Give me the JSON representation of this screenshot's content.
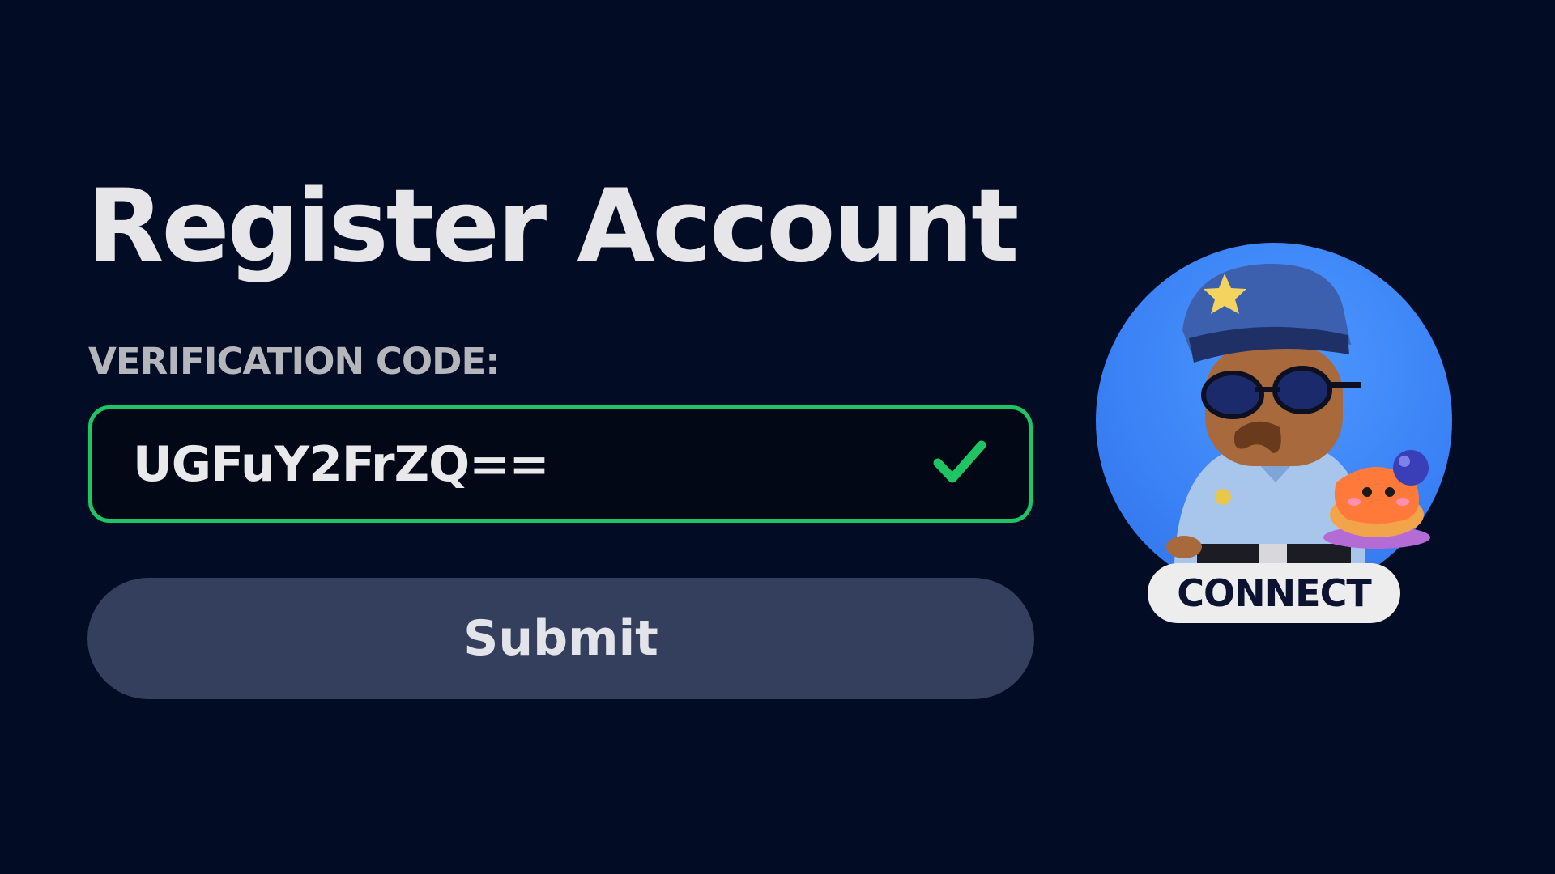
{
  "page": {
    "title": "Register Account"
  },
  "form": {
    "code_label": "VERIFICATION CODE:",
    "code_value": "UGFuY2FrZQ==",
    "code_valid": true,
    "submit_label": "Submit"
  },
  "badge": {
    "label": "CONNECT",
    "icon": "police-character-icon"
  },
  "colors": {
    "background": "#020c24",
    "valid_border": "#1fc465",
    "button": "#333f5c",
    "badge_circle": "#3b83f6"
  }
}
